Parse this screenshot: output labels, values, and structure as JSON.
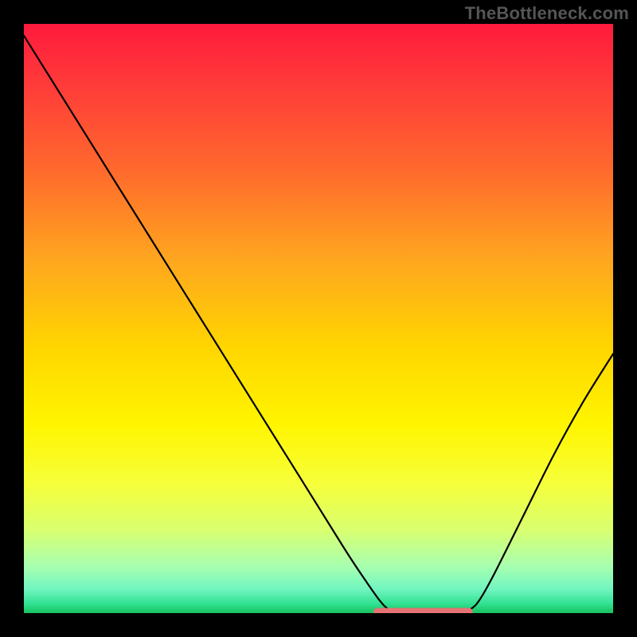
{
  "watermark": "TheBottleneck.com",
  "gradient_stops": [
    {
      "offset": 0.0,
      "color": "#ff1a3c"
    },
    {
      "offset": 0.1,
      "color": "#ff3a3a"
    },
    {
      "offset": 0.25,
      "color": "#ff6a2c"
    },
    {
      "offset": 0.4,
      "color": "#ffa61f"
    },
    {
      "offset": 0.55,
      "color": "#ffd600"
    },
    {
      "offset": 0.68,
      "color": "#fff500"
    },
    {
      "offset": 0.78,
      "color": "#f6ff3a"
    },
    {
      "offset": 0.86,
      "color": "#d8ff70"
    },
    {
      "offset": 0.92,
      "color": "#a8ffb0"
    },
    {
      "offset": 0.96,
      "color": "#70f5c0"
    },
    {
      "offset": 0.985,
      "color": "#2fe090"
    },
    {
      "offset": 1.0,
      "color": "#18c060"
    }
  ],
  "curve": {
    "color": "#000000",
    "width": 2.2,
    "points": [
      [
        0.0,
        0.98
      ],
      [
        0.05,
        0.9
      ],
      [
        0.1,
        0.82
      ],
      [
        0.15,
        0.74
      ],
      [
        0.2,
        0.66
      ],
      [
        0.25,
        0.58
      ],
      [
        0.3,
        0.5
      ],
      [
        0.35,
        0.42
      ],
      [
        0.4,
        0.34
      ],
      [
        0.45,
        0.26
      ],
      [
        0.5,
        0.18
      ],
      [
        0.55,
        0.1
      ],
      [
        0.58,
        0.055
      ],
      [
        0.605,
        0.02
      ],
      [
        0.62,
        0.006
      ],
      [
        0.64,
        0.0
      ],
      [
        0.7,
        0.0
      ],
      [
        0.74,
        0.0
      ],
      [
        0.76,
        0.008
      ],
      [
        0.775,
        0.025
      ],
      [
        0.8,
        0.07
      ],
      [
        0.85,
        0.17
      ],
      [
        0.9,
        0.27
      ],
      [
        0.95,
        0.36
      ],
      [
        1.0,
        0.44
      ]
    ]
  },
  "flat_segment": {
    "color": "#e57373",
    "width": 10,
    "cap_radius": 5,
    "x1": 0.6,
    "x2": 0.755,
    "y": 0.002
  },
  "chart_data": {
    "type": "line",
    "title": "",
    "xlabel": "",
    "ylabel": "",
    "xlim": [
      0,
      1
    ],
    "ylim": [
      0,
      1
    ],
    "series": [
      {
        "name": "bottleneck-curve",
        "x": [
          0.0,
          0.05,
          0.1,
          0.15,
          0.2,
          0.25,
          0.3,
          0.35,
          0.4,
          0.45,
          0.5,
          0.55,
          0.58,
          0.605,
          0.62,
          0.64,
          0.7,
          0.74,
          0.76,
          0.775,
          0.8,
          0.85,
          0.9,
          0.95,
          1.0
        ],
        "y": [
          0.98,
          0.9,
          0.82,
          0.74,
          0.66,
          0.58,
          0.5,
          0.42,
          0.34,
          0.26,
          0.18,
          0.1,
          0.055,
          0.02,
          0.006,
          0.0,
          0.0,
          0.0,
          0.008,
          0.025,
          0.07,
          0.17,
          0.27,
          0.36,
          0.44
        ]
      },
      {
        "name": "optimal-range-marker",
        "x": [
          0.6,
          0.755
        ],
        "y": [
          0.002,
          0.002
        ]
      }
    ],
    "annotations": [
      {
        "text": "TheBottleneck.com",
        "position": "top-right"
      }
    ]
  }
}
